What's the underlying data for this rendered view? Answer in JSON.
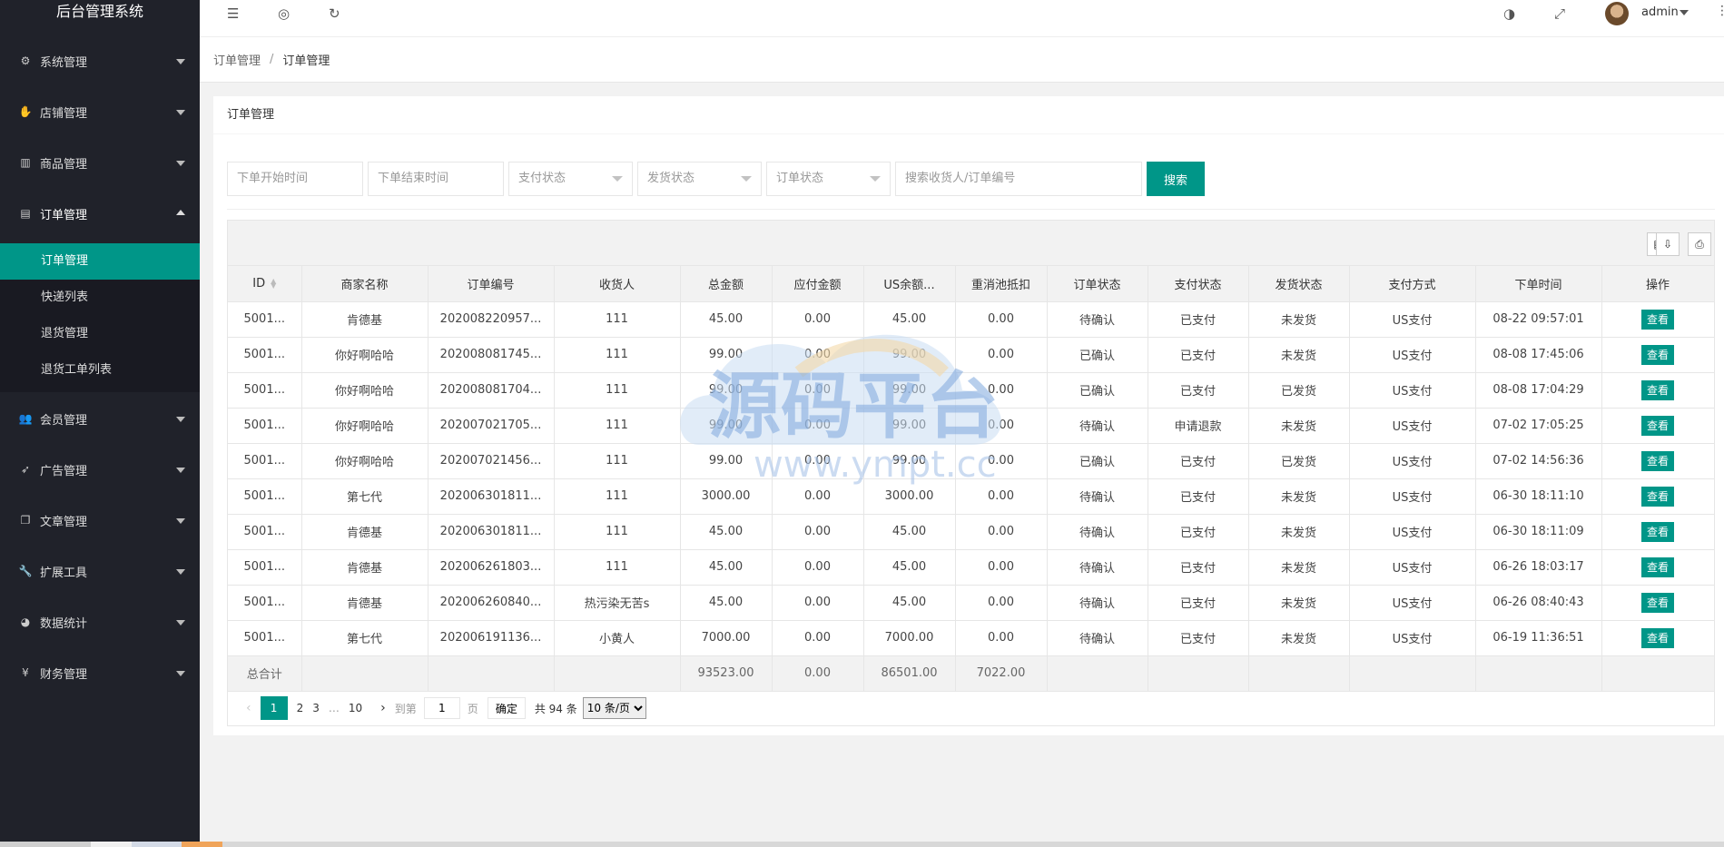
{
  "app": {
    "title": "后台管理系统"
  },
  "colors": {
    "primary": "#009688",
    "sidebar": "#20222a"
  },
  "sidebar": {
    "items": [
      {
        "label": "系统管理",
        "icon": "gear-icon",
        "glyph": "⚙"
      },
      {
        "label": "店铺管理",
        "icon": "hand-icon",
        "glyph": "✋"
      },
      {
        "label": "商品管理",
        "icon": "bar-chart-icon",
        "glyph": "▥"
      },
      {
        "label": "订单管理",
        "icon": "calendar-icon",
        "glyph": "▤"
      },
      {
        "label": "会员管理",
        "icon": "users-icon",
        "glyph": "👥"
      },
      {
        "label": "广告管理",
        "icon": "rocket-icon",
        "glyph": "➶"
      },
      {
        "label": "文章管理",
        "icon": "copy-icon",
        "glyph": "❐"
      },
      {
        "label": "扩展工具",
        "icon": "wrench-icon",
        "glyph": "🔧"
      },
      {
        "label": "数据统计",
        "icon": "pie-chart-icon",
        "glyph": "◕"
      },
      {
        "label": "财务管理",
        "icon": "yen-icon",
        "glyph": "¥"
      }
    ],
    "sub_items": [
      {
        "label": "订单管理"
      },
      {
        "label": "快递列表"
      },
      {
        "label": "退货管理"
      },
      {
        "label": "退货工单列表"
      }
    ]
  },
  "header": {
    "username": "admin"
  },
  "breadcrumb": {
    "parent": "订单管理",
    "separator": "/",
    "current": "订单管理"
  },
  "card": {
    "title": "订单管理"
  },
  "filters": {
    "start_time": "下单开始时间",
    "end_time": "下单结束时间",
    "pay_status": "支付状态",
    "ship_status": "发货状态",
    "order_status": "订单状态",
    "keyword": "搜索收货人/订单编号",
    "search_label": "搜索"
  },
  "table": {
    "columns": [
      "ID",
      "商家名称",
      "订单编号",
      "收货人",
      "总金额",
      "应付金额",
      "US余额...",
      "重消池抵扣",
      "订单状态",
      "支付状态",
      "发货状态",
      "支付方式",
      "下单时间",
      "操作"
    ],
    "rows": [
      [
        "5001...",
        "肯德基",
        "202008220957...",
        "111",
        "45.00",
        "0.00",
        "45.00",
        "0.00",
        "待确认",
        "已支付",
        "未发货",
        "US支付",
        "08-22 09:57:01",
        "查看"
      ],
      [
        "5001...",
        "你好啊哈哈",
        "202008081745...",
        "111",
        "99.00",
        "0.00",
        "99.00",
        "0.00",
        "已确认",
        "已支付",
        "未发货",
        "US支付",
        "08-08 17:45:06",
        "查看"
      ],
      [
        "5001...",
        "你好啊哈哈",
        "202008081704...",
        "111",
        "99.00",
        "0.00",
        "99.00",
        "0.00",
        "已确认",
        "已支付",
        "已发货",
        "US支付",
        "08-08 17:04:29",
        "查看"
      ],
      [
        "5001...",
        "你好啊哈哈",
        "202007021705...",
        "111",
        "99.00",
        "0.00",
        "99.00",
        "0.00",
        "待确认",
        "申请退款",
        "未发货",
        "US支付",
        "07-02 17:05:25",
        "查看"
      ],
      [
        "5001...",
        "你好啊哈哈",
        "202007021456...",
        "111",
        "99.00",
        "0.00",
        "99.00",
        "0.00",
        "已确认",
        "已支付",
        "已发货",
        "US支付",
        "07-02 14:56:36",
        "查看"
      ],
      [
        "5001...",
        "第七代",
        "202006301811...",
        "111",
        "3000.00",
        "0.00",
        "3000.00",
        "0.00",
        "待确认",
        "已支付",
        "未发货",
        "US支付",
        "06-30 18:11:10",
        "查看"
      ],
      [
        "5001...",
        "肯德基",
        "202006301811...",
        "111",
        "45.00",
        "0.00",
        "45.00",
        "0.00",
        "待确认",
        "已支付",
        "未发货",
        "US支付",
        "06-30 18:11:09",
        "查看"
      ],
      [
        "5001...",
        "肯德基",
        "202006261803...",
        "111",
        "45.00",
        "0.00",
        "45.00",
        "0.00",
        "待确认",
        "已支付",
        "未发货",
        "US支付",
        "06-26 18:03:17",
        "查看"
      ],
      [
        "5001...",
        "肯德基",
        "202006260840...",
        "热污染无苦s",
        "45.00",
        "0.00",
        "45.00",
        "0.00",
        "待确认",
        "已支付",
        "未发货",
        "US支付",
        "06-26 08:40:43",
        "查看"
      ],
      [
        "5001...",
        "第七代",
        "202006191136...",
        "小黄人",
        "7000.00",
        "0.00",
        "7000.00",
        "0.00",
        "待确认",
        "已支付",
        "未发货",
        "US支付",
        "06-19 11:36:51",
        "查看"
      ]
    ],
    "total": {
      "label": "总合计",
      "total_amount": "93523.00",
      "payable": "0.00",
      "us_balance": "86501.00",
      "pool_deduct": "7022.00"
    }
  },
  "pager": {
    "pages": [
      "1",
      "2",
      "3",
      "…",
      "10"
    ],
    "goto_label": "到第",
    "goto_value": "1",
    "page_unit": "页",
    "ok_label": "确定",
    "total_text": "共 94 条",
    "page_size": "10 条/页"
  },
  "watermark": {
    "text": "源码平台",
    "url": "www.ympt.cc"
  }
}
